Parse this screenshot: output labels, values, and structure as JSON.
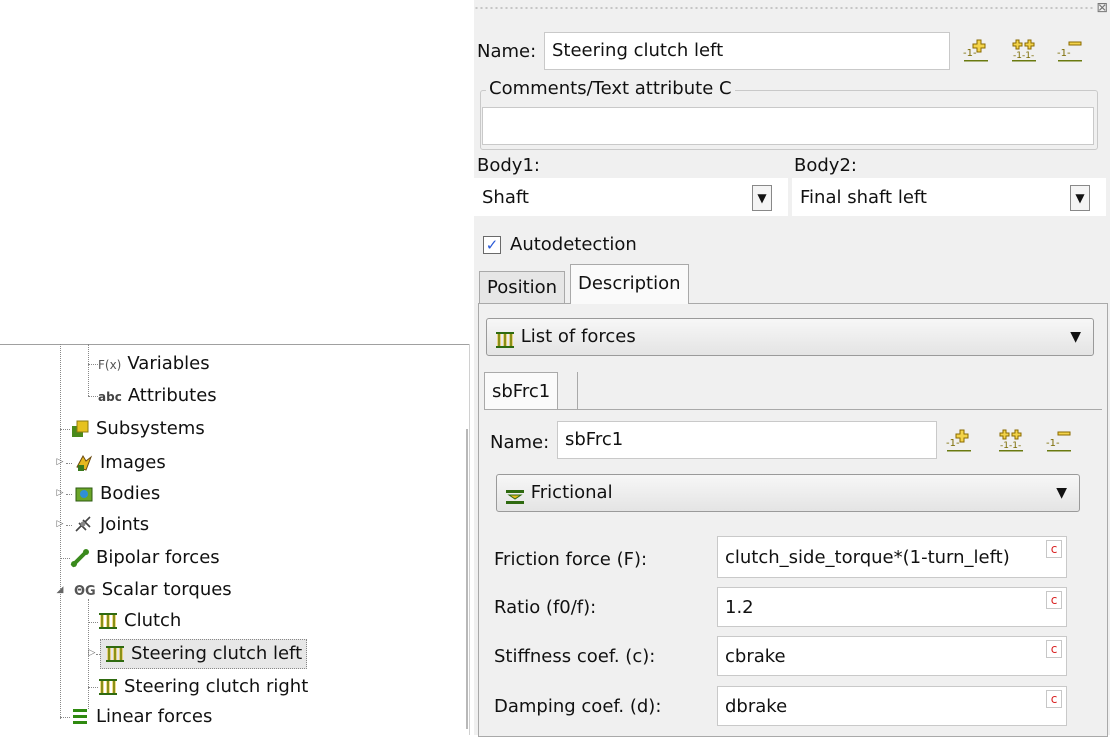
{
  "tree": {
    "items": [
      {
        "label": "Variables",
        "icon": "variables-fx-icon",
        "icon_text": "F(x)"
      },
      {
        "label": "Attributes",
        "icon": "attributes-abc-icon",
        "icon_text": "abc"
      },
      {
        "label": "Subsystems",
        "icon": "subsystems-icon"
      },
      {
        "label": "Images",
        "icon": "images-icon"
      },
      {
        "label": "Bodies",
        "icon": "bodies-icon"
      },
      {
        "label": "Joints",
        "icon": "joints-icon"
      },
      {
        "label": "Bipolar forces",
        "icon": "bipolar-forces-icon"
      },
      {
        "label": "Scalar torques",
        "icon": "scalar-torques-icon",
        "icon_text": "ΘG"
      },
      {
        "label": "Clutch",
        "icon": "force-element-icon"
      },
      {
        "label": "Steering clutch left",
        "icon": "force-element-icon"
      },
      {
        "label": "Steering clutch right",
        "icon": "force-element-icon"
      },
      {
        "label": "Linear forces",
        "icon": "linear-forces-icon"
      }
    ]
  },
  "panel": {
    "name_label": "Name:",
    "name_value": "Steering clutch left",
    "comments_label": "Comments/Text attribute C",
    "comments_value": "",
    "body1_label": "Body1:",
    "body1_value": "Shaft",
    "body2_label": "Body2:",
    "body2_value": "Final shaft left",
    "autodetection_label": "Autodetection",
    "autodetection_checked": "✓",
    "tabs": [
      {
        "label": "Position"
      },
      {
        "label": "Description"
      }
    ],
    "description": {
      "list_combo_value": "List of forces",
      "subtab_label": "sbFrc1",
      "name_label": "Name:",
      "name_value": "sbFrc1",
      "type_combo_value": "Frictional",
      "params": [
        {
          "label": "Friction force (F):",
          "value": "clutch_side_torque*(1-turn_left)",
          "c": "c"
        },
        {
          "label": "Ratio (f0/f):",
          "value": "1.2",
          "c": "c"
        },
        {
          "label": "Stiffness coef. (c):",
          "value": "cbrake",
          "c": "c"
        },
        {
          "label": "Damping coef. (d):",
          "value": "dbrake",
          "c": "c"
        }
      ]
    }
  },
  "colors": {
    "icon_green": "#4a8a1c",
    "icon_yellow": "#e6c21e",
    "panel_bg": "#f0f0f0"
  }
}
